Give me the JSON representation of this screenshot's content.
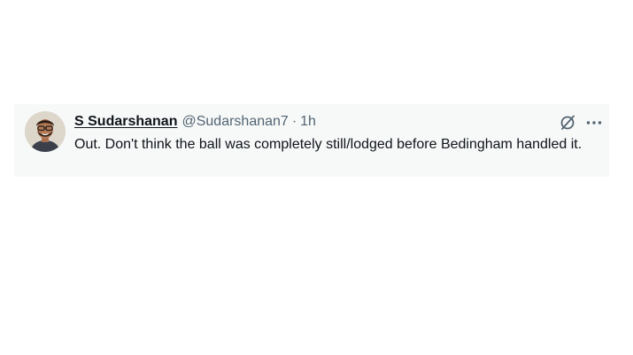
{
  "tweet": {
    "display_name": "S Sudarshanan",
    "handle": "@Sudarshanan7",
    "separator": "·",
    "timestamp": "1h",
    "text": "Out. Don't think the ball was completely still/lodged before Bedingham handled it."
  },
  "icons": {
    "avatar": "profile-photo",
    "grok": "grok-icon",
    "more": "more-options-icon"
  },
  "colors": {
    "background": "#ffffff",
    "tweet_background": "#f7f9f9",
    "primary_text": "#0f1419",
    "secondary_text": "#536471"
  }
}
